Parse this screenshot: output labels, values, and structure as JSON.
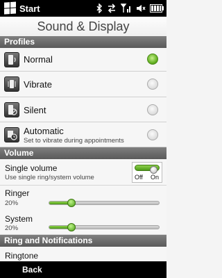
{
  "status_bar": {
    "start_label": "Start",
    "icons": [
      "bluetooth-icon",
      "data-sync-icon",
      "signal-strength-icon",
      "speaker-muted-icon",
      "battery-icon"
    ]
  },
  "title": "Sound & Display",
  "profiles": {
    "header": "Profiles",
    "items": [
      {
        "label": "Normal",
        "icon": "phone-speaker-icon",
        "checked": true
      },
      {
        "label": "Vibrate",
        "icon": "phone-vibrate-icon",
        "checked": false
      },
      {
        "label": "Silent",
        "icon": "phone-silent-icon",
        "checked": false
      },
      {
        "label": "Automatic",
        "sub": "Set to vibrate during appointments",
        "icon": "calendar-clock-icon",
        "checked": false
      }
    ]
  },
  "volume": {
    "header": "Volume",
    "single_volume": {
      "label": "Single volume",
      "sub": "Use single ring/system volume",
      "toggle_off": "Off",
      "toggle_on": "On",
      "state": "on"
    },
    "ringer": {
      "label": "Ringer",
      "value_text": "20%",
      "level": 0.2
    },
    "system": {
      "label": "System",
      "value_text": "20%",
      "level": 0.2
    }
  },
  "ring": {
    "header": "Ring and Notifications",
    "ringtone_label": "Ringtone"
  },
  "bottom_bar": {
    "back_label": "Back"
  },
  "colors": {
    "accent_green": "#5fae1e",
    "header_gray": "#6b6b6b"
  }
}
